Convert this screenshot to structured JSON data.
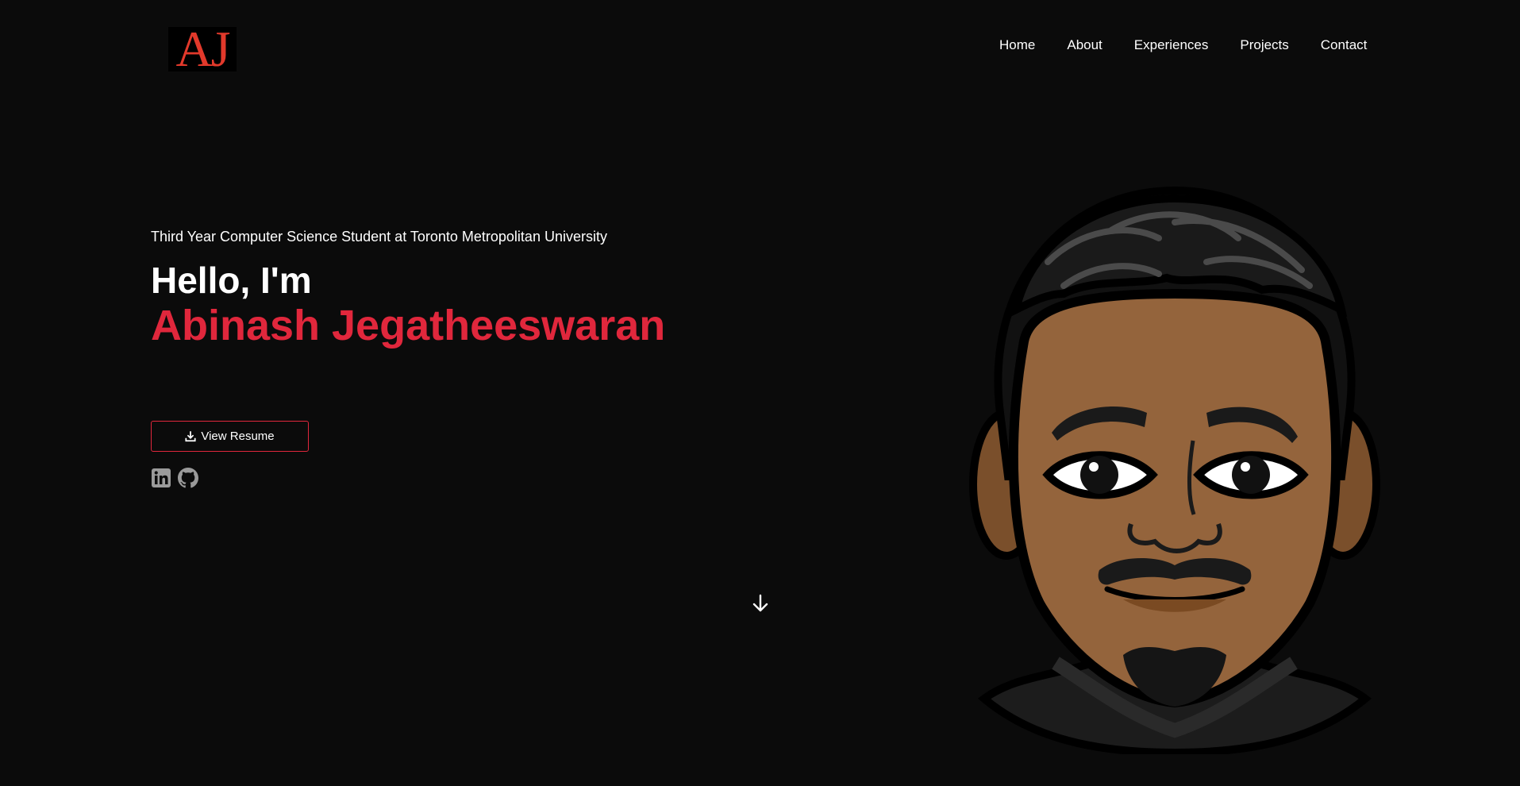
{
  "logo": {
    "text": "AJ"
  },
  "nav": {
    "items": [
      {
        "label": "Home"
      },
      {
        "label": "About"
      },
      {
        "label": "Experiences"
      },
      {
        "label": "Projects"
      },
      {
        "label": "Contact"
      }
    ]
  },
  "hero": {
    "subtitle": "Third Year Computer Science Student at Toronto Metropolitan University",
    "greeting": "Hello, I'm",
    "name": "Abinash Jegatheeswaran",
    "resume_label": "View Resume"
  },
  "socials": [
    {
      "icon": "linkedin-icon"
    },
    {
      "icon": "github-icon"
    }
  ],
  "colors": {
    "background": "#0b0b0b",
    "accent": "#e0273c",
    "logo": "#e2392b",
    "icon_gray": "#9a9a9a"
  }
}
